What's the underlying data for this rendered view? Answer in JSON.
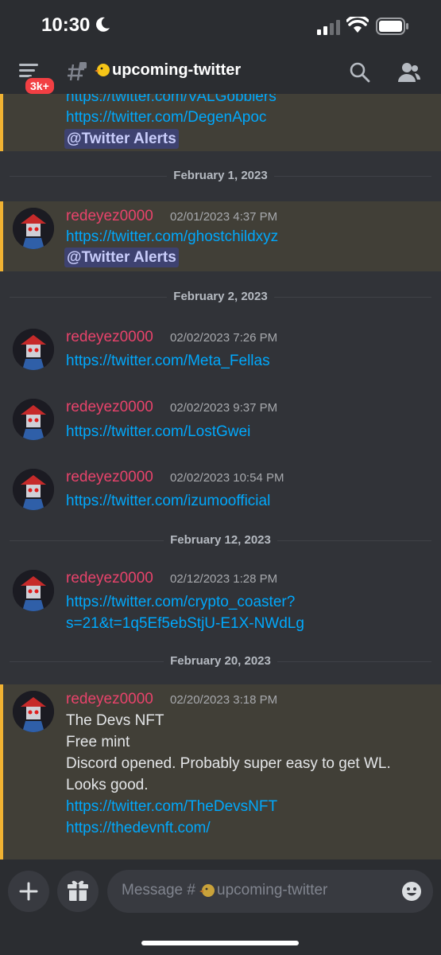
{
  "status_bar": {
    "time": "10:30"
  },
  "header": {
    "badge": "3k+",
    "channel_name": "upcoming-twitter",
    "channel_emoji": "duck-emoji"
  },
  "partial_message": {
    "lines": [
      "https://twitter.com/VALGobblers",
      "https://twitter.com/DegenApoc"
    ],
    "mention": "@Twitter Alerts"
  },
  "dividers": [
    "February 1, 2023",
    "February 2, 2023",
    "February 12, 2023",
    "February 20, 2023"
  ],
  "messages": [
    {
      "author": "redeyez0000",
      "timestamp": "02/01/2023 4:37 PM",
      "lines": [
        "https://twitter.com/ghostchildxyz"
      ],
      "mention": "@Twitter Alerts",
      "highlighted": true
    },
    {
      "author": "redeyez0000",
      "timestamp": "02/02/2023 7:26 PM",
      "lines": [
        "https://twitter.com/Meta_Fellas"
      ],
      "highlighted": false
    },
    {
      "author": "redeyez0000",
      "timestamp": "02/02/2023 9:37 PM",
      "lines": [
        "https://twitter.com/LostGwei"
      ],
      "highlighted": false
    },
    {
      "author": "redeyez0000",
      "timestamp": "02/02/2023 10:54 PM",
      "lines": [
        "https://twitter.com/izumoofficial"
      ],
      "highlighted": false
    },
    {
      "author": "redeyez0000",
      "timestamp": "02/12/2023 1:28 PM",
      "lines": [
        "https://twitter.com/crypto_coaster?",
        "s=21&t=1q5Ef5ebStjU-E1X-NWdLg"
      ],
      "highlighted": false
    },
    {
      "author": "redeyez0000",
      "timestamp": "02/20/2023 3:18 PM",
      "lines": [
        "The Devs NFT",
        "Free mint",
        "Discord opened. Probably super easy to get WL.",
        "Looks good.",
        "https://twitter.com/TheDevsNFT",
        "https://thedevnft.com/"
      ],
      "highlighted": true
    }
  ],
  "composer": {
    "placeholder_prefix": "Message #",
    "placeholder_channel": "upcoming-twitter"
  },
  "colors": {
    "background": "#313338",
    "username": "#e8436b",
    "link": "#00a8fc",
    "highlight": "#413f37",
    "highlight_bar": "#f0b232",
    "badge": "#f23f43"
  }
}
